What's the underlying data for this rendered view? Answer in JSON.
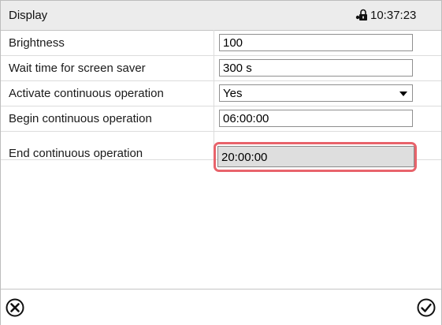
{
  "header": {
    "title": "Display",
    "lock_icon": "lock-icon",
    "time": "10:37:23"
  },
  "settings": [
    {
      "label": "Brightness",
      "value": "100",
      "type": "text"
    },
    {
      "label": "Wait time for screen saver",
      "value": "300 s",
      "type": "text"
    },
    {
      "label": "Activate continuous operation",
      "value": "Yes",
      "type": "select"
    },
    {
      "label": "Begin continuous operation",
      "value": "06:00:00",
      "type": "text"
    },
    {
      "label": "End continuous operation",
      "value": "20:00:00",
      "type": "text",
      "highlighted": true
    }
  ],
  "footer": {
    "cancel_icon": "cancel-icon",
    "confirm_icon": "confirm-icon"
  },
  "colors": {
    "highlight": "#e8636b",
    "header_bg": "#ececec",
    "active_field_bg": "#dedede"
  }
}
